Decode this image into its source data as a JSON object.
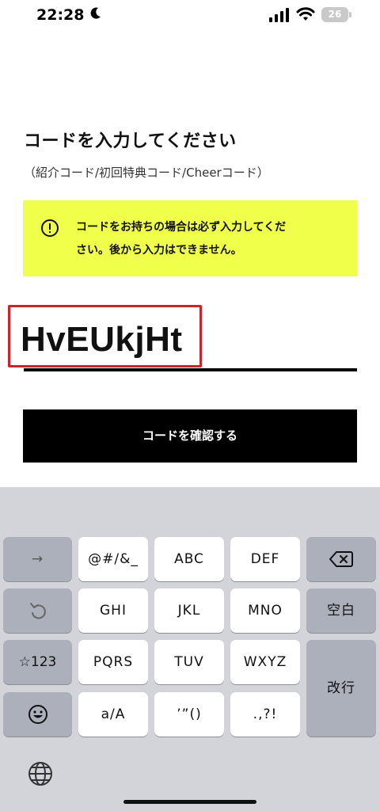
{
  "status": {
    "time": "22:28",
    "battery": "26"
  },
  "page": {
    "title": "コードを入力してください",
    "subtitle": "（紹介コード/初回特典コード/Cheerコード）",
    "notice_line1": "コードをお持ちの場合は必ず入力してくだ",
    "notice_line2": "さい。後から入力はできません。",
    "code_value": "HvEUkjHt",
    "confirm_label": "コードを確認する"
  },
  "colors": {
    "notice_bg": "#f0ff4a",
    "highlight_border": "#c8242c",
    "button_bg": "#000000"
  },
  "keyboard": {
    "row1": [
      "→",
      "@#/&_",
      "ABC",
      "DEF",
      "backspace-icon"
    ],
    "row2": [
      "undo-icon",
      "GHI",
      "JKL",
      "MNO",
      "空白"
    ],
    "row3": [
      "☆123",
      "PQRS",
      "TUV",
      "WXYZ",
      "改行"
    ],
    "row4": [
      "emoji-icon",
      "a/A",
      "’”()",
      ".,?!"
    ],
    "labels": {
      "arrow": "→",
      "symbols": "@#/&_",
      "abc": "ABC",
      "def": "DEF",
      "ghi": "GHI",
      "jkl": "JKL",
      "mno": "MNO",
      "space": "空白",
      "num": "☆123",
      "pqrs": "PQRS",
      "tuv": "TUV",
      "wxyz": "WXYZ",
      "enter": "改行",
      "case": "a/A",
      "quotes": "’”()",
      "punct": ".,?!"
    }
  }
}
